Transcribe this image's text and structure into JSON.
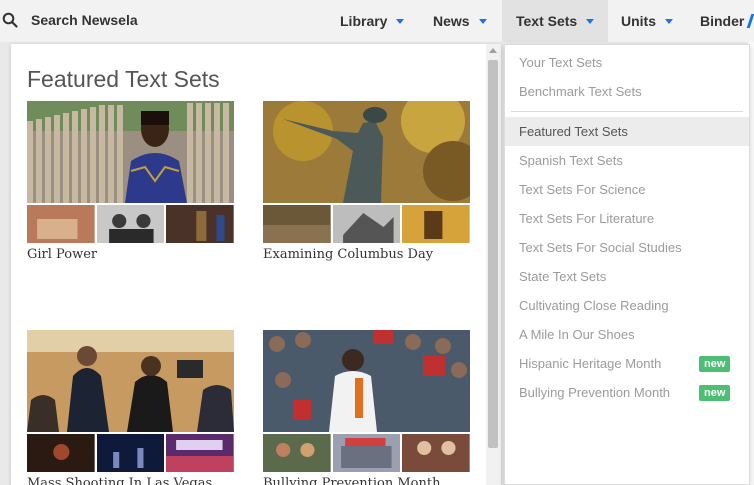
{
  "search": {
    "label": "Search Newsela"
  },
  "nav": {
    "library": "Library",
    "news": "News",
    "text_sets": "Text Sets",
    "units": "Units",
    "binder": "Binder"
  },
  "featured": {
    "title": "Featured Text Sets",
    "cards": [
      {
        "title": "Girl Power"
      },
      {
        "title": "Examining Columbus Day"
      },
      {
        "title": "Mass Shooting In Las Vegas"
      },
      {
        "title": "Bullying Prevention Month"
      }
    ]
  },
  "menu": {
    "items": [
      {
        "label": "Your Text Sets"
      },
      {
        "label": "Benchmark Text Sets"
      },
      {
        "label": "Featured Text Sets"
      },
      {
        "label": "Spanish Text Sets"
      },
      {
        "label": "Text Sets For Science"
      },
      {
        "label": "Text Sets For Literature"
      },
      {
        "label": "Text Sets For Social Studies"
      },
      {
        "label": "State Text Sets"
      },
      {
        "label": "Cultivating Close Reading"
      },
      {
        "label": "A Mile In Our Shoes"
      },
      {
        "label": "Hispanic Heritage Month",
        "badge": "new"
      },
      {
        "label": "Bullying Prevention Month",
        "badge": "new"
      }
    ]
  },
  "colors": {
    "accent": "#1a73e8",
    "badge": "#4cbf74",
    "active_item": "#ececec"
  }
}
